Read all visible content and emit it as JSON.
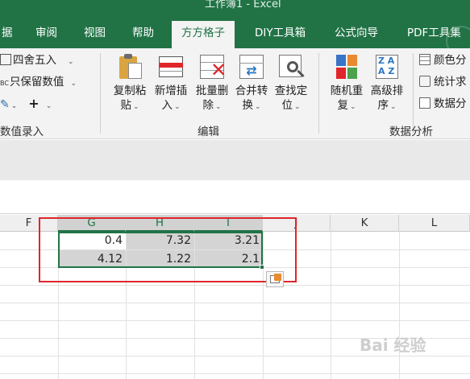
{
  "window": {
    "title": "工作簿1  -  Excel"
  },
  "tabs": [
    {
      "label": "据"
    },
    {
      "label": "审阅"
    },
    {
      "label": "视图"
    },
    {
      "label": "帮助"
    },
    {
      "label": "方方格子",
      "active": true
    },
    {
      "label": "DIY工具箱"
    },
    {
      "label": "公式向导"
    },
    {
      "label": "PDF工具集"
    }
  ],
  "ribbon": {
    "number_group": {
      "round_label": "四舍五入",
      "keep_label": "只保留数值",
      "plus_label": "+",
      "group_label": "数值录入"
    },
    "edit_group": {
      "buttons": [
        {
          "line1": "复制粘",
          "line2": "贴"
        },
        {
          "line1": "新增插",
          "line2": "入"
        },
        {
          "line1": "批量删",
          "line2": "除"
        },
        {
          "line1": "合并转",
          "line2": "换"
        },
        {
          "line1": "查找定",
          "line2": "位"
        }
      ],
      "group_label": "编辑"
    },
    "analysis_group": {
      "buttons": [
        {
          "line1": "随机重",
          "line2": "复"
        },
        {
          "line1": "高级排",
          "line2": "序"
        }
      ],
      "small_items": [
        "颜色分",
        "统计求",
        "数据分"
      ],
      "group_label": "数据分析"
    }
  },
  "sheet": {
    "columns": [
      "F",
      "G",
      "H",
      "I",
      "J",
      "K",
      "L"
    ],
    "selected_columns": [
      "G",
      "H",
      "I"
    ],
    "rows": [
      [
        "0.4",
        "7.32",
        "3.21"
      ],
      [
        "4.12",
        "1.22",
        "2.1"
      ]
    ]
  },
  "colors": {
    "accent": "#217346",
    "highlight": "#e0252b"
  },
  "watermark": "Bai  经验"
}
